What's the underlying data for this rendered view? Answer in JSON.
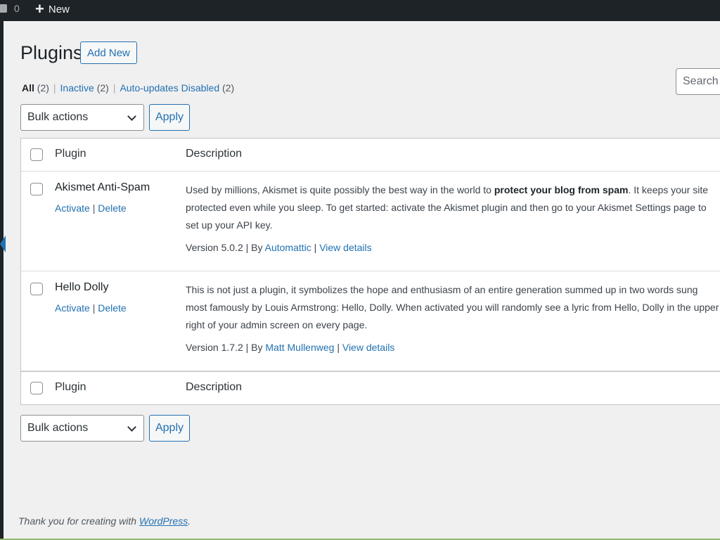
{
  "adminbar": {
    "comments_icon": "comment-bubble-icon",
    "comments_count": "0",
    "new_icon": "plus-icon",
    "new_label": "New"
  },
  "page": {
    "title": "Plugins",
    "add_new_label": "Add New",
    "search_placeholder": "Search installed plugins..."
  },
  "filters": [
    {
      "label": "All",
      "count": "(2)",
      "current": true
    },
    {
      "label": "Inactive",
      "count": "(2)",
      "current": false
    },
    {
      "label": "Auto-updates Disabled",
      "count": "(2)",
      "current": false
    }
  ],
  "bulk": {
    "selected": "Bulk actions",
    "apply_label": "Apply"
  },
  "table": {
    "columns": {
      "plugin": "Plugin",
      "description": "Description"
    },
    "rows": [
      {
        "name": "Akismet Anti-Spam",
        "actions": {
          "activate": "Activate",
          "delete": "Delete"
        },
        "description_pre": "Used by millions, Akismet is quite possibly the best way in the world to ",
        "description_bold": "protect your blog from spam",
        "description_post": ". It keeps your site protected even while you sleep. To get started: activate the Akismet plugin and then go to your Akismet Settings page to set up your API key.",
        "version": "Version 5.0.2",
        "by": "By",
        "author": "Automattic",
        "view_details": "View details"
      },
      {
        "name": "Hello Dolly",
        "actions": {
          "activate": "Activate",
          "delete": "Delete"
        },
        "description_pre": "This is not just a plugin, it symbolizes the hope and enthusiasm of an entire generation summed up in two words sung most famously by Louis Armstrong: Hello, Dolly. When activated you will randomly see a lyric from Hello, Dolly in the upper right of your admin screen on every page.",
        "description_bold": "",
        "description_post": "",
        "version": "Version 1.7.2",
        "by": "By",
        "author": "Matt Mullenweg",
        "view_details": "View details"
      }
    ]
  },
  "footer": {
    "text": "Thank you for creating with ",
    "link": "WordPress",
    "suffix": "."
  }
}
